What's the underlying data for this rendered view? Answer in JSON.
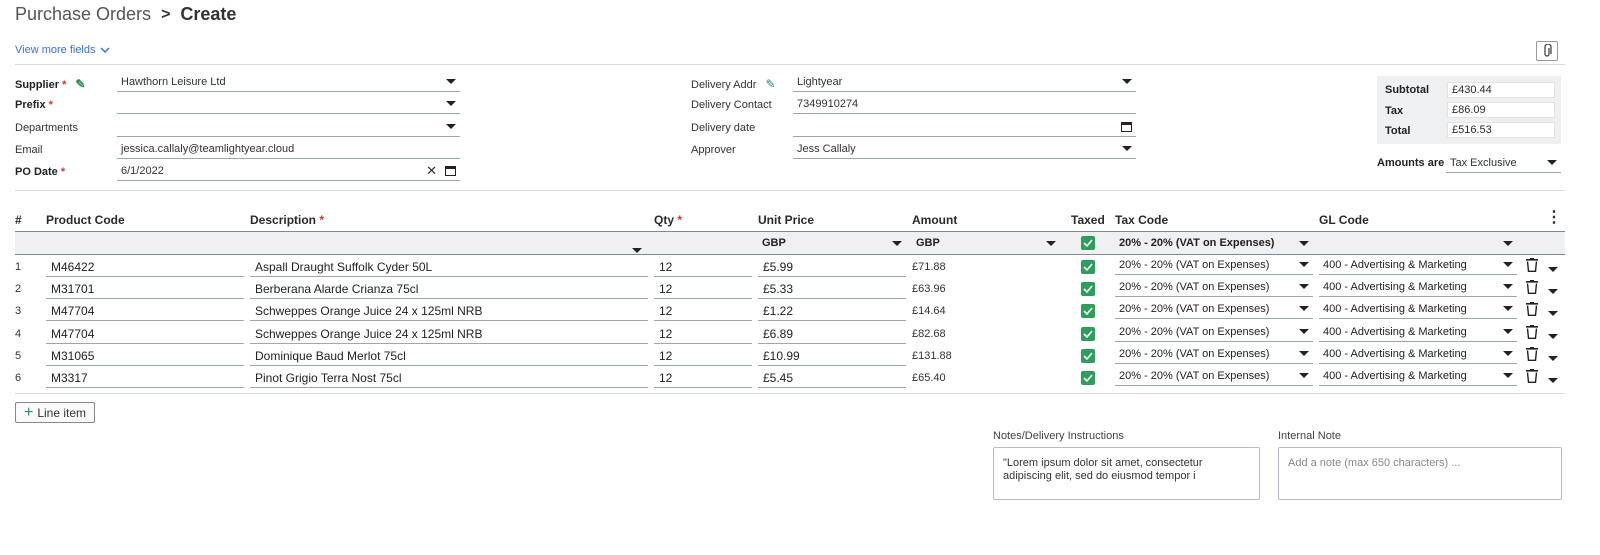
{
  "breadcrumb": {
    "parent": "Purchase Orders",
    "separator": ">",
    "current": "Create"
  },
  "view_more": "View more fields",
  "form": {
    "supplier": {
      "label": "Supplier",
      "required": "*",
      "value": "Hawthorn Leisure Ltd"
    },
    "prefix": {
      "label": "Prefix",
      "required": "*",
      "value": ""
    },
    "departments": {
      "label": "Departments",
      "value": ""
    },
    "email": {
      "label": "Email",
      "value": "jessica.callaly@teamlightyear.cloud"
    },
    "po_date": {
      "label": "PO Date",
      "required": "*",
      "value": "6/1/2022"
    },
    "delivery_addr": {
      "label": "Delivery Addr",
      "value": "Lightyear"
    },
    "delivery_contact": {
      "label": "Delivery Contact",
      "value": "7349910274"
    },
    "delivery_date": {
      "label": "Delivery date",
      "value": ""
    },
    "approver": {
      "label": "Approver",
      "value": "Jess Callaly"
    }
  },
  "totals": {
    "subtotal_label": "Subtotal",
    "subtotal": "£430.44",
    "tax_label": "Tax",
    "tax": "£86.09",
    "total_label": "Total",
    "total": "£516.53",
    "amounts_are_label": "Amounts are",
    "amounts_are": "Tax Exclusive"
  },
  "table": {
    "headers": {
      "num": "#",
      "product_code": "Product Code",
      "description": "Description",
      "desc_req": "*",
      "qty": "Qty",
      "qty_req": "*",
      "unit_price": "Unit Price",
      "amount": "Amount",
      "taxed": "Taxed",
      "tax_code": "Tax Code",
      "gl_code": "GL Code"
    },
    "filters": {
      "unit_price_currency": "GBP",
      "amount_currency": "GBP",
      "tax_code": "20% - 20% (VAT on Expenses)"
    },
    "rows": [
      {
        "num": "1",
        "code": "M46422",
        "desc": "Aspall Draught Suffolk Cyder 50L",
        "qty": "12",
        "price": "£5.99",
        "amount": "£71.88",
        "tax": "20% - 20% (VAT on Expenses)",
        "gl": "400 - Advertising & Marketing"
      },
      {
        "num": "2",
        "code": "M31701",
        "desc": "Berberana Alarde Crianza  75cl",
        "qty": "12",
        "price": "£5.33",
        "amount": "£63.96",
        "tax": "20% - 20% (VAT on Expenses)",
        "gl": "400 - Advertising & Marketing"
      },
      {
        "num": "3",
        "code": "M47704",
        "desc": "Schweppes Orange Juice  24 x 125ml NRB",
        "qty": "12",
        "price": "£1.22",
        "amount": "£14.64",
        "tax": "20% - 20% (VAT on Expenses)",
        "gl": "400 - Advertising & Marketing"
      },
      {
        "num": "4",
        "code": "M47704",
        "desc": "Schweppes Orange Juice  24 x 125ml NRB",
        "qty": "12",
        "price": "£6.89",
        "amount": "£82.68",
        "tax": "20% - 20% (VAT on Expenses)",
        "gl": "400 - Advertising & Marketing"
      },
      {
        "num": "5",
        "code": "M31065",
        "desc": "Dominique Baud Merlot  75cl",
        "qty": "12",
        "price": "£10.99",
        "amount": "£131.88",
        "tax": "20% - 20% (VAT on Expenses)",
        "gl": "400 - Advertising & Marketing"
      },
      {
        "num": "6",
        "code": "M3317",
        "desc": "Pinot Grigio Terra Nost  75cl",
        "qty": "12",
        "price": "£5.45",
        "amount": "£65.40",
        "tax": "20% - 20% (VAT on Expenses)",
        "gl": "400 - Advertising & Marketing"
      }
    ]
  },
  "line_item_button": "Line item",
  "notes": {
    "delivery_label": "Notes/Delivery Instructions",
    "delivery_value": "\"Lorem ipsum dolor sit amet, consectetur adipiscing elit, sed do eiusmod tempor i",
    "internal_label": "Internal Note",
    "internal_placeholder": "Add a note (max 650 characters) ..."
  },
  "colors": {
    "accent_link": "#3b6fd6",
    "check_green": "#2e9e5b",
    "required_red": "#d0342c"
  }
}
